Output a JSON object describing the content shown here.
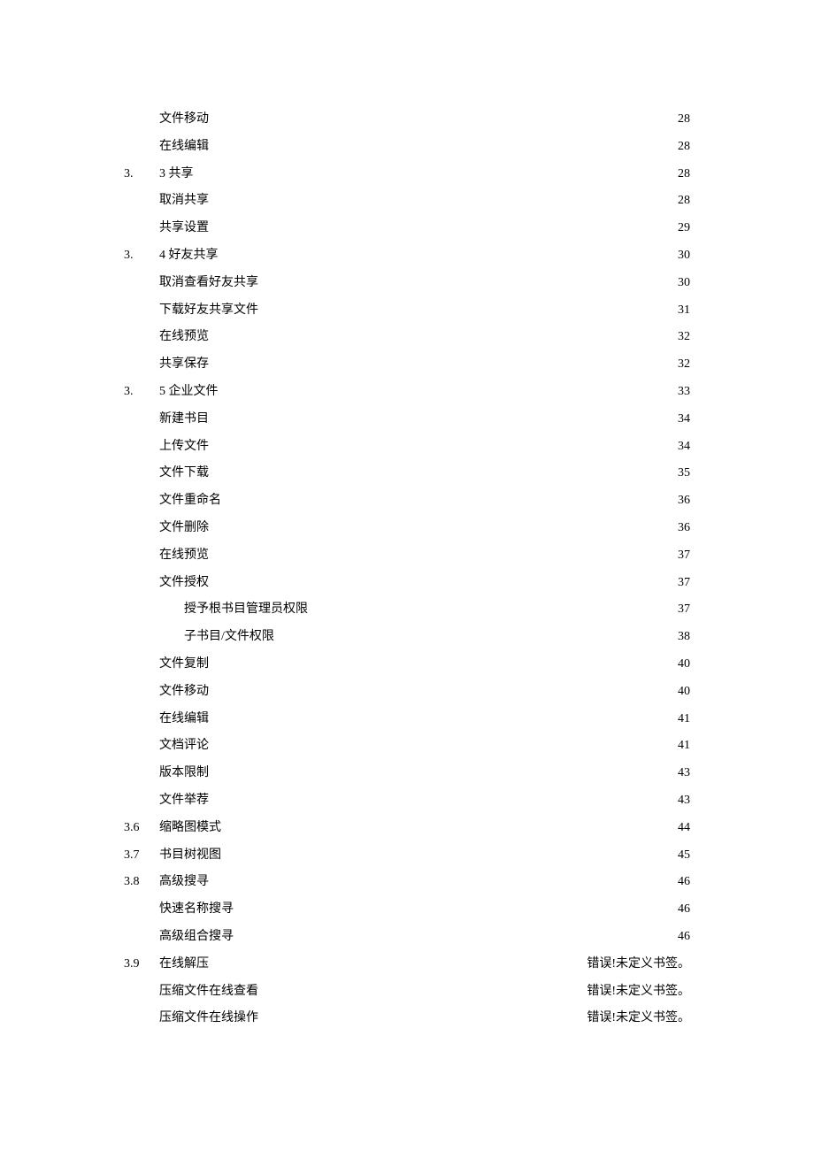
{
  "toc": [
    {
      "level": "entry",
      "num": "",
      "title": "文件移动",
      "page": "28"
    },
    {
      "level": "entry",
      "num": "",
      "title": "在线编辑",
      "page": "28"
    },
    {
      "level": "section",
      "num": "3.",
      "title": "3 共享",
      "page": "28"
    },
    {
      "level": "entry",
      "num": "",
      "title": "取消共享",
      "page": "28"
    },
    {
      "level": "entry",
      "num": "",
      "title": "共享设置",
      "page": "29"
    },
    {
      "level": "section",
      "num": "3.",
      "title": "4 好友共享",
      "page": "30"
    },
    {
      "level": "entry",
      "num": "",
      "title": "取消查看好友共享",
      "page": "30"
    },
    {
      "level": "entry",
      "num": "",
      "title": "下载好友共享文件",
      "page": "31"
    },
    {
      "level": "entry",
      "num": "",
      "title": "在线预览",
      "page": "32"
    },
    {
      "level": "entry",
      "num": "",
      "title": "共享保存",
      "page": "32"
    },
    {
      "level": "section",
      "num": "3.",
      "title": "5 企业文件",
      "page": "33"
    },
    {
      "level": "entry",
      "num": "",
      "title": "新建书目",
      "page": "34"
    },
    {
      "level": "entry",
      "num": "",
      "title": "上传文件",
      "page": "34"
    },
    {
      "level": "entry",
      "num": "",
      "title": "文件下载",
      "page": "35"
    },
    {
      "level": "entry",
      "num": "",
      "title": "文件重命名",
      "page": "36"
    },
    {
      "level": "entry",
      "num": "",
      "title": "文件删除",
      "page": "36"
    },
    {
      "level": "entry",
      "num": "",
      "title": "在线预览",
      "page": "37"
    },
    {
      "level": "entry",
      "num": "",
      "title": "文件授权",
      "page": "37"
    },
    {
      "level": "sub",
      "num": "",
      "title": "授予根书目管理员权限",
      "page": "37"
    },
    {
      "level": "sub",
      "num": "",
      "title": "子书目/文件权限",
      "page": "38"
    },
    {
      "level": "entry",
      "num": "",
      "title": "文件复制",
      "page": "40"
    },
    {
      "level": "entry",
      "num": "",
      "title": "文件移动",
      "page": "40"
    },
    {
      "level": "entry",
      "num": "",
      "title": "在线编辑",
      "page": "41"
    },
    {
      "level": "entry",
      "num": "",
      "title": "文档评论",
      "page": "41"
    },
    {
      "level": "entry",
      "num": "",
      "title": "版本限制",
      "page": "43"
    },
    {
      "level": "entry",
      "num": "",
      "title": "文件举荐",
      "page": "43"
    },
    {
      "level": "section",
      "num": "3.6",
      "title": "缩略图模式",
      "page": "44"
    },
    {
      "level": "section",
      "num": "3.7",
      "title": "书目树视图",
      "page": "45"
    },
    {
      "level": "section",
      "num": "3.8",
      "title": "高级搜寻",
      "page": "46"
    },
    {
      "level": "entry",
      "num": "",
      "title": "快速名称搜寻",
      "page": "46"
    },
    {
      "level": "entry",
      "num": "",
      "title": "高级组合搜寻",
      "page": "46"
    },
    {
      "level": "section",
      "num": "3.9",
      "title": "在线解压",
      "page": "错误!未定义书签。"
    },
    {
      "level": "entry",
      "num": "",
      "title": "压缩文件在线查看",
      "page": "错误!未定义书签。"
    },
    {
      "level": "entry",
      "num": "",
      "title": "压缩文件在线操作",
      "page": "错误!未定义书签。"
    }
  ]
}
